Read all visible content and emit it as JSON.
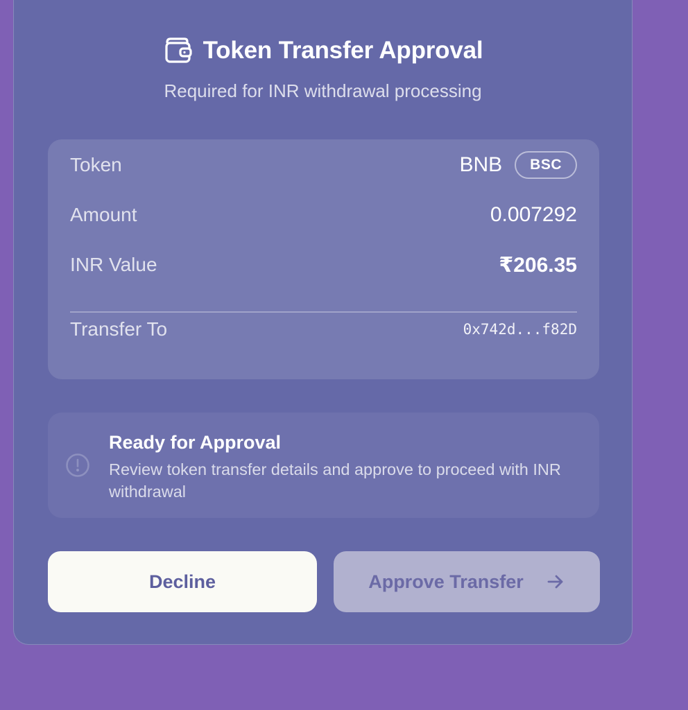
{
  "dialog": {
    "title": "Token Transfer Approval",
    "subtitle": "Required for INR withdrawal processing",
    "icon": "wallet-icon"
  },
  "details": {
    "token_label": "Token",
    "token_value": "BNB",
    "chain_badge": "BSC",
    "amount_label": "Amount",
    "amount_value": "0.007292",
    "inr_label": "INR Value",
    "inr_value": "₹206.35",
    "transfer_label": "Transfer To",
    "transfer_value": "0x742d...f82D"
  },
  "notice": {
    "icon": "info-circle-icon",
    "title": "Ready for Approval",
    "body": "Review token transfer details and approve to proceed with INR withdrawal"
  },
  "actions": {
    "decline_label": "Decline",
    "approve_label": "Approve Transfer",
    "approve_icon": "arrow-right-icon"
  },
  "colors": {
    "background": "#7f60b5",
    "card": "#6569a8",
    "decline_bg": "#fafaf5",
    "approve_bg": "#b1b1cf",
    "button_text": "#5d5f9e"
  }
}
